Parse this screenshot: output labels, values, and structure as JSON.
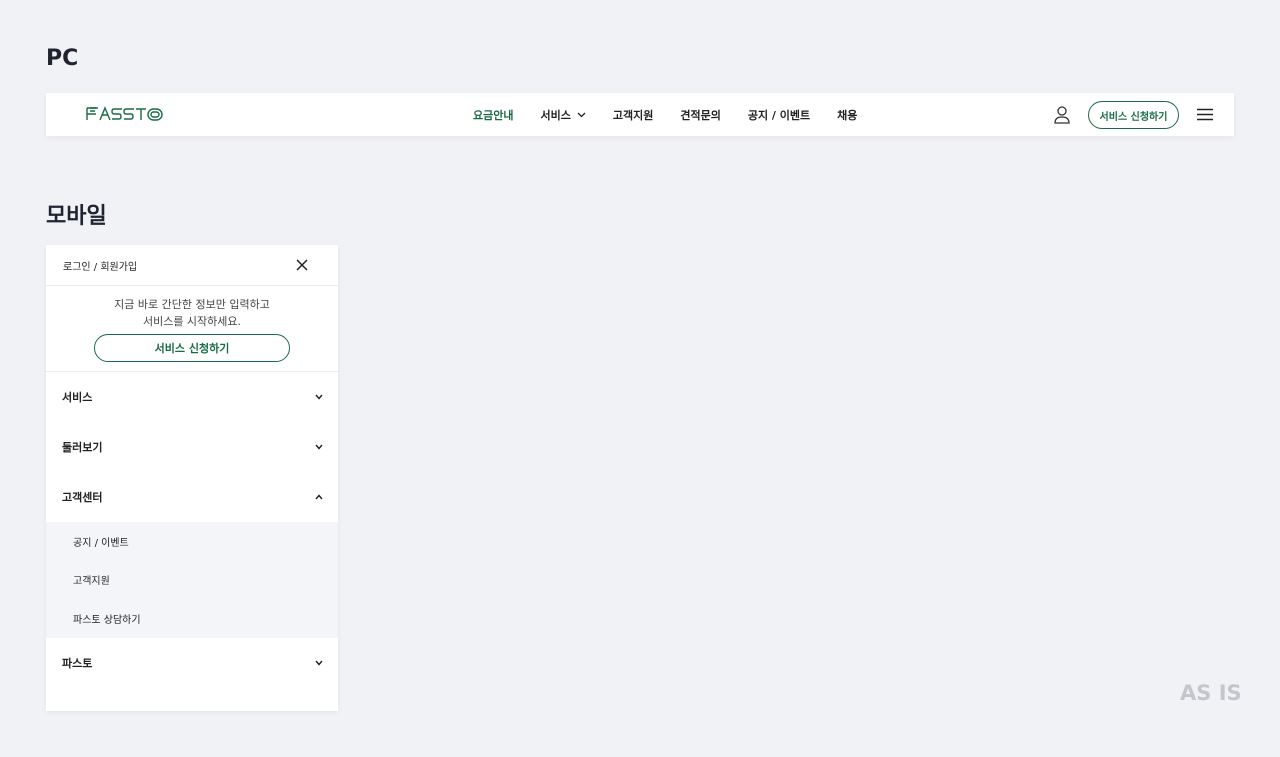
{
  "sections": {
    "pc_title": "PC",
    "mobile_title": "모바일"
  },
  "pc_header": {
    "logo_text": "FASSTO",
    "nav": [
      {
        "label": "요금안내",
        "active": true
      },
      {
        "label": "서비스",
        "has_dropdown": true
      },
      {
        "label": "고객지원"
      },
      {
        "label": "견적문의"
      },
      {
        "label": "공지 / 이벤트"
      },
      {
        "label": "채용"
      }
    ],
    "cta_label": "서비스 신청하기"
  },
  "mobile_menu": {
    "login_label": "로그인 / 회원가입",
    "promo_line1": "지금 바로 간단한 정보만 입력하고",
    "promo_line2": "서비스를 시작하세요.",
    "cta_label": "서비스 신청하기",
    "items": [
      {
        "label": "서비스",
        "expanded": false
      },
      {
        "label": "둘러보기",
        "expanded": false
      },
      {
        "label": "고객센터",
        "expanded": true,
        "children": [
          "공지 / 이벤트",
          "고객지원",
          "파스토 상담하기"
        ]
      },
      {
        "label": "파스토",
        "expanded": false
      }
    ]
  },
  "watermark": "AS IS",
  "colors": {
    "brand_green": "#1a6b45",
    "background": "#f1f2f6",
    "watermark": "#c4c6cb"
  }
}
